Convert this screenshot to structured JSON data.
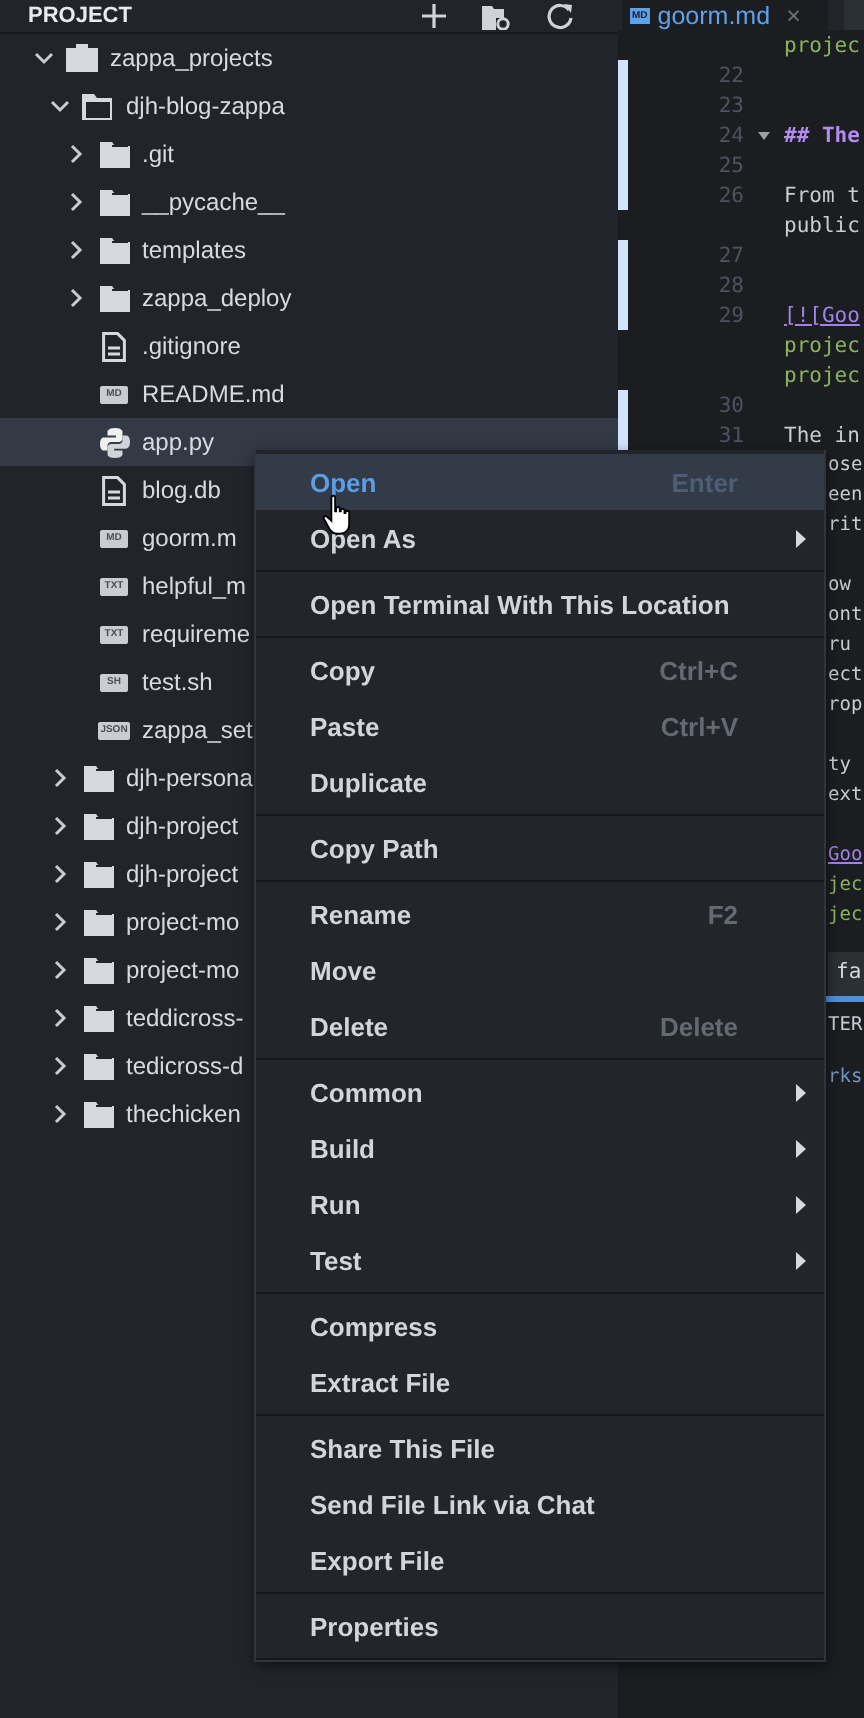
{
  "sidebar": {
    "title": "PROJECT",
    "tree": [
      {
        "name": "zappa_projects",
        "kind": "folder",
        "expanded": true,
        "selected": false,
        "children": [
          {
            "name": "djh-blog-zappa",
            "kind": "folder",
            "expanded": true,
            "selected": false,
            "children": [
              {
                "name": ".git",
                "kind": "folder",
                "expanded": false,
                "selected": false
              },
              {
                "name": "__pycache__",
                "kind": "folder",
                "expanded": false,
                "selected": false
              },
              {
                "name": "templates",
                "kind": "folder",
                "expanded": false,
                "selected": false
              },
              {
                "name": "zappa_deploy",
                "kind": "folder",
                "expanded": false,
                "selected": false
              },
              {
                "name": ".gitignore",
                "kind": "file",
                "selected": false
              },
              {
                "name": "README.md",
                "kind": "file",
                "badge": "MD",
                "selected": false
              },
              {
                "name": "app.py",
                "kind": "python",
                "selected": true
              },
              {
                "name": "blog.db",
                "kind": "file",
                "selected": false
              },
              {
                "name": "goorm.m",
                "kind": "file",
                "badge": "MD",
                "selected": false
              },
              {
                "name": "helpful_m",
                "kind": "file",
                "badge": "TXT",
                "selected": false
              },
              {
                "name": "requireme",
                "kind": "file",
                "badge": "TXT",
                "selected": false
              },
              {
                "name": "test.sh",
                "kind": "file",
                "badge": "SH",
                "selected": false
              },
              {
                "name": "zappa_set",
                "kind": "file",
                "badge": "JSON",
                "selected": false
              }
            ]
          },
          {
            "name": "djh-persona",
            "kind": "folder",
            "expanded": false,
            "selected": false
          },
          {
            "name": "djh-project",
            "kind": "folder",
            "expanded": false,
            "selected": false
          },
          {
            "name": "djh-project",
            "kind": "folder",
            "expanded": false,
            "selected": false
          },
          {
            "name": "project-mo",
            "kind": "folder",
            "expanded": false,
            "selected": false
          },
          {
            "name": "project-mo",
            "kind": "folder",
            "expanded": false,
            "selected": false
          },
          {
            "name": "teddicross-",
            "kind": "folder",
            "expanded": false,
            "selected": false
          },
          {
            "name": "tedicross-d",
            "kind": "folder",
            "expanded": false,
            "selected": false
          },
          {
            "name": "thechicken",
            "kind": "folder",
            "expanded": false,
            "selected": false
          }
        ]
      }
    ]
  },
  "editor": {
    "tab": {
      "badge": "MD",
      "title": "goorm.md",
      "close": "×"
    },
    "lines": [
      {
        "text": "projec",
        "kind": "url",
        "changed": false
      },
      {
        "number": "22",
        "changed": true
      },
      {
        "number": "23",
        "changed": true
      },
      {
        "number": "24",
        "text": "## The",
        "kind": "heading",
        "changed": true,
        "fold": true
      },
      {
        "number": "25",
        "changed": true
      },
      {
        "number": "26",
        "text": "From t",
        "kind": "text",
        "changed": true
      },
      {
        "text": "public",
        "kind": "text",
        "changed": false
      },
      {
        "number": "27",
        "changed": true
      },
      {
        "number": "28",
        "changed": true
      },
      {
        "number": "29",
        "text": "[![Goo",
        "kind": "link",
        "changed": true
      },
      {
        "text": "projec",
        "kind": "url",
        "changed": false
      },
      {
        "text": "projec",
        "kind": "url",
        "changed": false
      },
      {
        "number": "30",
        "changed": true
      },
      {
        "number": "31",
        "text": "The in",
        "kind": "text",
        "changed": true
      }
    ],
    "fragments": [
      {
        "text": "ose",
        "kind": "text"
      },
      {
        "text": "een",
        "kind": "text"
      },
      {
        "text": "rit",
        "kind": "text"
      },
      {
        "kind": "blank"
      },
      {
        "text": "ow",
        "kind": "text"
      },
      {
        "text": "ont",
        "kind": "text"
      },
      {
        "text": "ru",
        "kind": "text"
      },
      {
        "text": "ect",
        "kind": "text"
      },
      {
        "text": "rop",
        "kind": "text"
      },
      {
        "kind": "blank"
      },
      {
        "text": "ty",
        "kind": "text"
      },
      {
        "text": "ext",
        "kind": "text"
      },
      {
        "kind": "blank"
      },
      {
        "text": "Goo",
        "kind": "link"
      },
      {
        "text": "jec",
        "kind": "url"
      },
      {
        "text": "jec",
        "kind": "url"
      }
    ],
    "panel": {
      "tab": "fa",
      "lines": [
        {
          "text": "TER",
          "kind": "text"
        },
        {
          "text": "rks",
          "kind": "info"
        }
      ]
    }
  },
  "context_menu": {
    "groups": [
      [
        {
          "label": "Open",
          "shortcut": "Enter",
          "submenu": false,
          "highlighted": true
        },
        {
          "label": "Open As",
          "submenu": true,
          "highlighted": false
        }
      ],
      [
        {
          "label": "Open Terminal With This Location",
          "submenu": false,
          "highlighted": false
        }
      ],
      [
        {
          "label": "Copy",
          "shortcut": "Ctrl+C",
          "submenu": false,
          "highlighted": false
        },
        {
          "label": "Paste",
          "shortcut": "Ctrl+V",
          "submenu": false,
          "highlighted": false
        },
        {
          "label": "Duplicate",
          "submenu": false,
          "highlighted": false
        }
      ],
      [
        {
          "label": "Copy Path",
          "submenu": false,
          "highlighted": false
        }
      ],
      [
        {
          "label": "Rename",
          "shortcut": "F2",
          "submenu": false,
          "highlighted": false
        },
        {
          "label": "Move",
          "submenu": false,
          "highlighted": false
        },
        {
          "label": "Delete",
          "shortcut": "Delete",
          "submenu": false,
          "highlighted": false
        }
      ],
      [
        {
          "label": "Common",
          "submenu": true,
          "highlighted": false
        },
        {
          "label": "Build",
          "submenu": true,
          "highlighted": false
        },
        {
          "label": "Run",
          "submenu": true,
          "highlighted": false
        },
        {
          "label": "Test",
          "submenu": true,
          "highlighted": false
        }
      ],
      [
        {
          "label": "Compress",
          "submenu": false,
          "highlighted": false
        },
        {
          "label": "Extract File",
          "submenu": false,
          "highlighted": false
        }
      ],
      [
        {
          "label": "Share This File",
          "submenu": false,
          "highlighted": false
        },
        {
          "label": "Send File Link via Chat",
          "submenu": false,
          "highlighted": false
        },
        {
          "label": "Export File",
          "submenu": false,
          "highlighted": false
        }
      ],
      [
        {
          "label": "Properties",
          "submenu": false,
          "highlighted": false
        }
      ]
    ]
  }
}
